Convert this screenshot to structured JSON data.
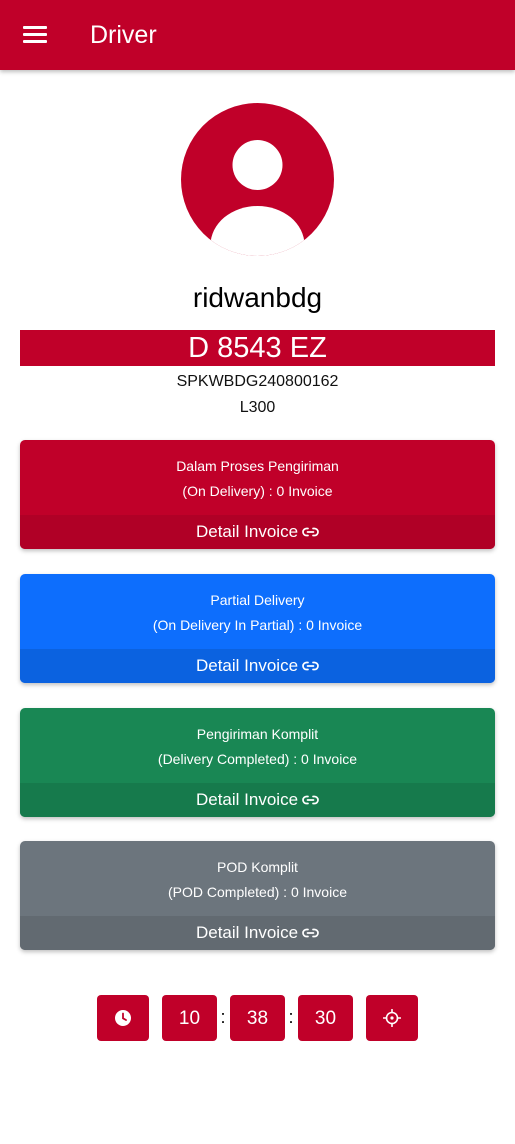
{
  "appbar": {
    "title": "Driver"
  },
  "profile": {
    "username": "ridwanbdg",
    "plate_number": "D 8543 EZ",
    "spk_code": "SPKWBDG240800162",
    "vehicle_type": "L300"
  },
  "cards": [
    {
      "title": "Dalam Proses Pengiriman",
      "subtitle": "(On Delivery) : 0 Invoice",
      "link_label": "Detail Invoice",
      "color": "#c00029"
    },
    {
      "title": "Partial Delivery",
      "subtitle": "(On Delivery In Partial) : 0 Invoice",
      "link_label": "Detail Invoice",
      "color": "#0d6efd"
    },
    {
      "title": "Pengiriman Komplit",
      "subtitle": "(Delivery Completed) : 0 Invoice",
      "link_label": "Detail Invoice",
      "color": "#198754"
    },
    {
      "title": "POD Komplit",
      "subtitle": "(POD Completed) : 0 Invoice",
      "link_label": "Detail Invoice",
      "color": "#6c757d"
    }
  ],
  "clock": {
    "hours": "10",
    "minutes": "38",
    "seconds": "30",
    "separator": ":"
  },
  "icons": {
    "menu": "hamburger-menu-icon",
    "avatar": "user-avatar-icon",
    "link": "link-icon",
    "clock": "clock-icon",
    "location": "crosshair-location-icon"
  },
  "colors": {
    "primary": "#c00029",
    "blue": "#0d6efd",
    "green": "#198754",
    "gray": "#6c757d"
  }
}
